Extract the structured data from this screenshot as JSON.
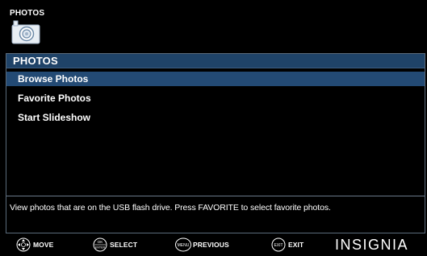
{
  "screen": {
    "title": "PHOTOS"
  },
  "panel": {
    "header": "PHOTOS",
    "items": [
      {
        "label": "Browse Photos",
        "selected": true
      },
      {
        "label": "Favorite Photos",
        "selected": false
      },
      {
        "label": "Start Slideshow",
        "selected": false
      }
    ],
    "help": "View photos that are on the USB flash drive. Press FAVORITE to select favorite photos."
  },
  "footer": {
    "hints": [
      {
        "button": "dpad",
        "label": "MOVE"
      },
      {
        "button": "OK ENTER",
        "label": "SELECT"
      },
      {
        "button": "MENU",
        "label": "PREVIOUS"
      },
      {
        "button": "EXIT",
        "label": "EXIT"
      }
    ],
    "brand": "INSIGNIA"
  },
  "colors": {
    "background": "#000000",
    "header_bar": "#1f4368",
    "selected_row": "#234a74",
    "panel_border": "#5b6b7b",
    "text": "#ffffff"
  }
}
